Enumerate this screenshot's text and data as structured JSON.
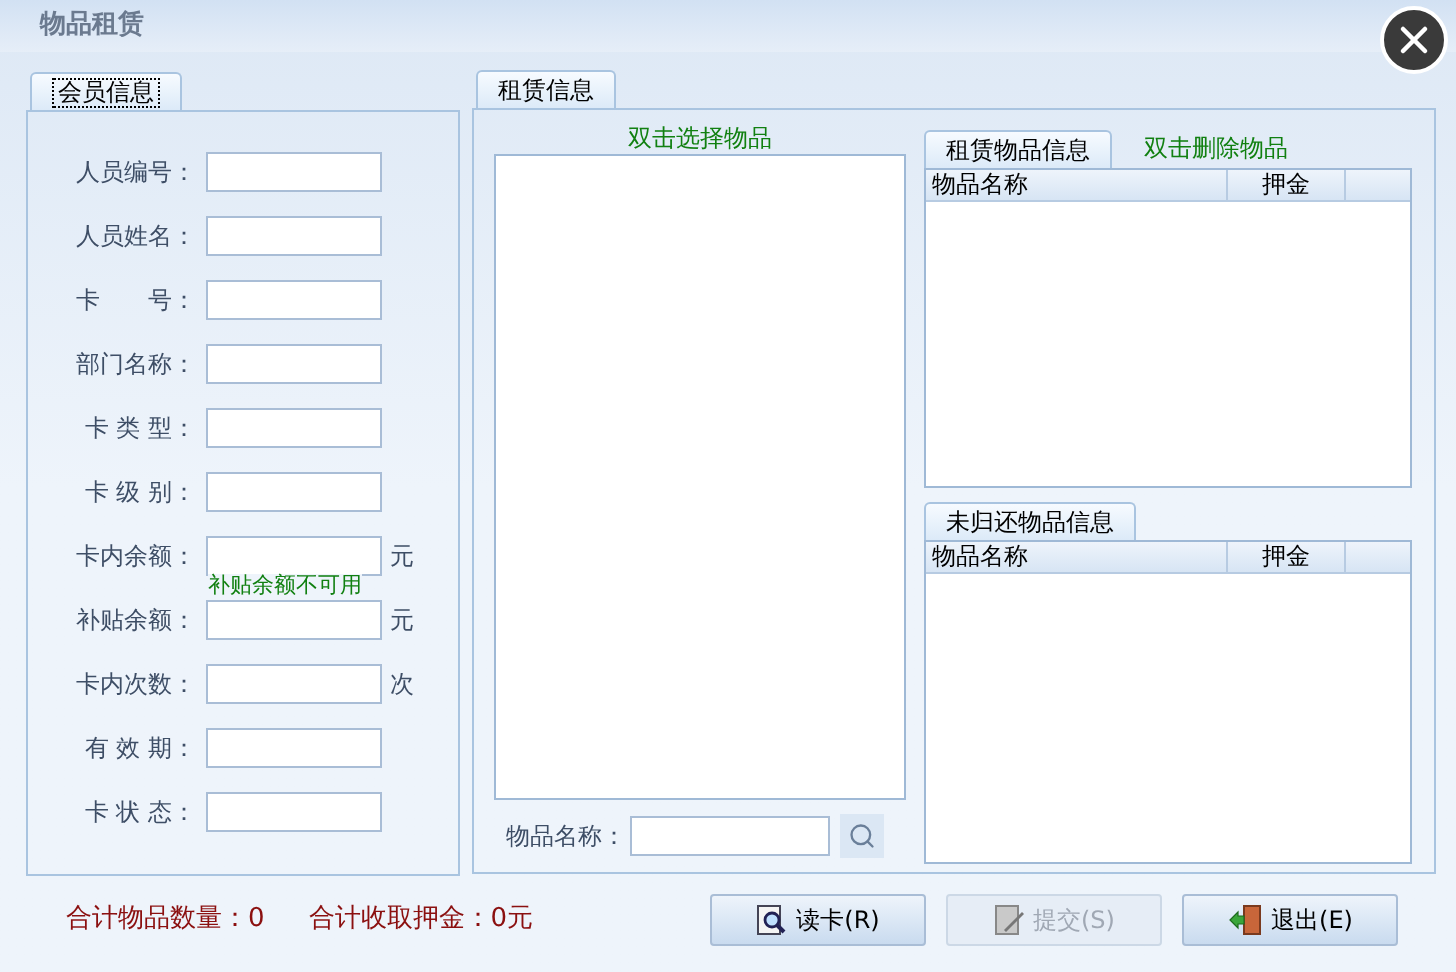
{
  "window": {
    "title": "物品租赁"
  },
  "member_panel": {
    "tab": {
      "label": "会员信息",
      "selected": true
    },
    "fields": [
      {
        "label": "人员编号："
      },
      {
        "label": "人员姓名："
      },
      {
        "label": "卡　　号："
      },
      {
        "label": "部门名称："
      },
      {
        "label": "卡 类 型："
      },
      {
        "label": "卡 级 别："
      },
      {
        "label": "卡内余额：",
        "unit": "元",
        "note": "补贴余额不可用"
      },
      {
        "label": "补贴余额：",
        "unit": "元"
      },
      {
        "label": "卡内次数：",
        "unit": "次"
      },
      {
        "label": "有 效 期："
      },
      {
        "label": "卡 状 态："
      }
    ]
  },
  "rental_panel": {
    "tab": {
      "label": "租赁信息",
      "selected": true
    },
    "item_hint": "双击选择物品",
    "search_label": "物品名称：",
    "rented_table": {
      "tab": {
        "label": "租赁物品信息",
        "selected": true
      },
      "hint": "双击删除物品",
      "columns": [
        "物品名称",
        "押金"
      ]
    },
    "unreturned_table": {
      "tab": {
        "label": "未归还物品信息",
        "selected": true
      },
      "columns": [
        "物品名称",
        "押金"
      ]
    }
  },
  "totals": [
    "合计物品数量：0",
    "合计收取押金：0元"
  ],
  "buttons": [
    {
      "kind": "read",
      "label": "读卡(R)",
      "disabled": false
    },
    {
      "kind": "submit",
      "label": "提交(S)",
      "disabled": true
    },
    {
      "kind": "exit",
      "label": "退出(E)",
      "disabled": false
    }
  ]
}
